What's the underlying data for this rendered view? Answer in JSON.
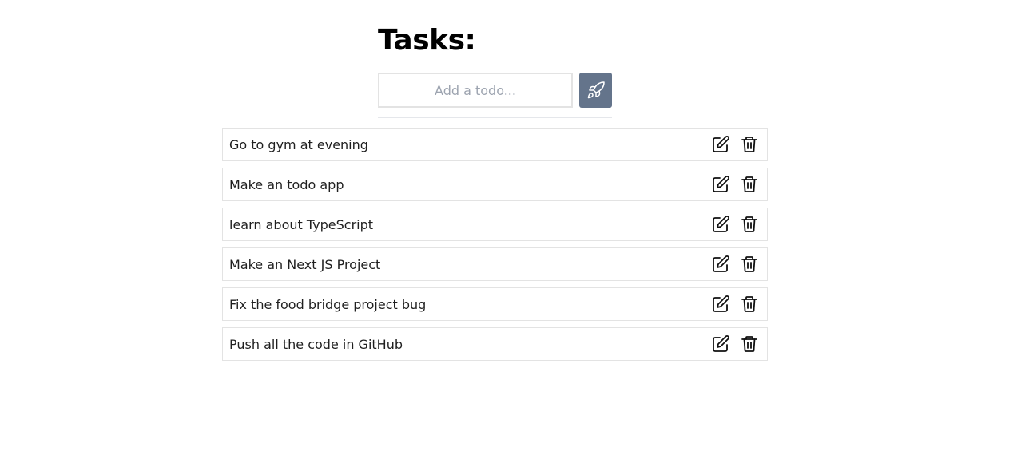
{
  "header": {
    "title": "Tasks:"
  },
  "add_form": {
    "placeholder": "Add a todo...",
    "value": "",
    "button_icon": "rocket-icon",
    "button_color": "#64748b"
  },
  "todos": [
    {
      "text": "Go to gym at evening"
    },
    {
      "text": "Make an todo app"
    },
    {
      "text": "learn about TypeScript"
    },
    {
      "text": "Make an Next JS Project"
    },
    {
      "text": "Fix the food bridge project bug"
    },
    {
      "text": "Push all the code in GitHub"
    }
  ],
  "item_actions": {
    "edit_icon": "edit-icon",
    "delete_icon": "trash-icon"
  }
}
